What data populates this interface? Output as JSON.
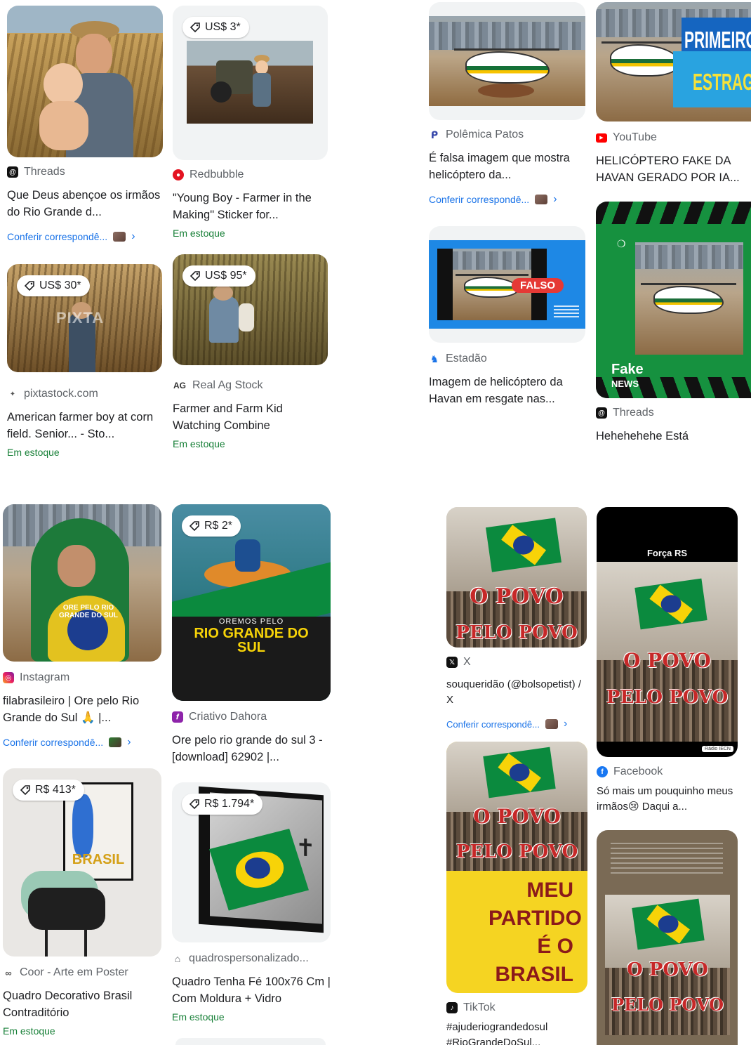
{
  "cards": {
    "c1": {
      "source": "Threads",
      "title": "Que Deus abençoe os irmãos do Rio Grande d...",
      "check": "Conferir correspondê..."
    },
    "c2": {
      "price": "US$ 3*",
      "source": "Redbubble",
      "title": "\"Young Boy - Farmer in the Making\" Sticker for...",
      "stock": "Em estoque"
    },
    "c3": {
      "price": "US$ 30*",
      "watermark": "PIXTA",
      "source": "pixtastock.com",
      "title": "American farmer boy at corn field. Senior... - Sto...",
      "stock": "Em estoque"
    },
    "c4": {
      "price": "US$ 95*",
      "source_logo": "AG",
      "source": "Real Ag Stock",
      "title": "Farmer and Farm Kid Watching Combine",
      "stock": "Em estoque"
    },
    "c5": {
      "source": "Polêmica Patos",
      "title": "É falsa imagem que mostra helicóptero da...",
      "check": "Conferir correspondê..."
    },
    "c6": {
      "overlay_top": "PRIMEIROS",
      "overlay_bottom": "ESTRAGOS",
      "source": "YouTube",
      "title": "HELICÓPTERO FAKE DA HAVAN GERADO POR IA..."
    },
    "c7": {
      "badge": "FALSO",
      "source": "Estadão",
      "title": "Imagem de helicóptero da Havan em resgate nas..."
    },
    "c8": {
      "logo_top": "Fake",
      "logo_bottom": "NEWS",
      "source": "Threads",
      "title": "Hehehehehe Está"
    },
    "c9": {
      "image_text": "ORE PELO RIO GRANDE DO SUL",
      "source": "Instagram",
      "title": "filabrasileiro | Ore pelo Rio Grande do Sul 🙏 |...",
      "check": "Conferir correspondê..."
    },
    "c10": {
      "price": "R$ 2*",
      "image_small": "OREMOS PELO",
      "image_big": "RIO GRANDE DO SUL",
      "source": "Criativo Dahora",
      "title": "Ore pelo rio grande do sul 3 - [download] 62902 |..."
    },
    "c11": {
      "price": "R$ 413*",
      "poster_text": "BRASIL",
      "source": "Coor - Arte em Poster",
      "title": "Quadro Decorativo Brasil Contraditório",
      "stock": "Em estoque"
    },
    "c12": {
      "price": "R$ 1.794*",
      "source": "quadrospersonalizado...",
      "title": "Quadro Tenha Fé 100x76 Cm | Com Moldura + Vidro",
      "stock": "Em estoque"
    },
    "c13": {
      "line1": "O POVO",
      "line2": "PELO POVO",
      "source": "X",
      "title": "souqueridão (@bolsopetist) / X",
      "check": "Conferir correspondê..."
    },
    "c14": {
      "header": "Força RS",
      "line1": "O POVO",
      "line2": "PELO POVO",
      "footer": "Rádio IECN",
      "source": "Facebook",
      "title": "Só mais um pouquinho meus irmãos😢 Daqui a..."
    },
    "c15": {
      "line1": "O POVO",
      "line2": "PELO POVO",
      "yellow_text": "MEU PARTIDO É O BRASIL",
      "source": "TikTok",
      "title": "#ajuderiograndedosul #RioGrandeDoSul..."
    },
    "c16": {
      "line1": "O POVO",
      "line2": "PELO POVO"
    }
  }
}
